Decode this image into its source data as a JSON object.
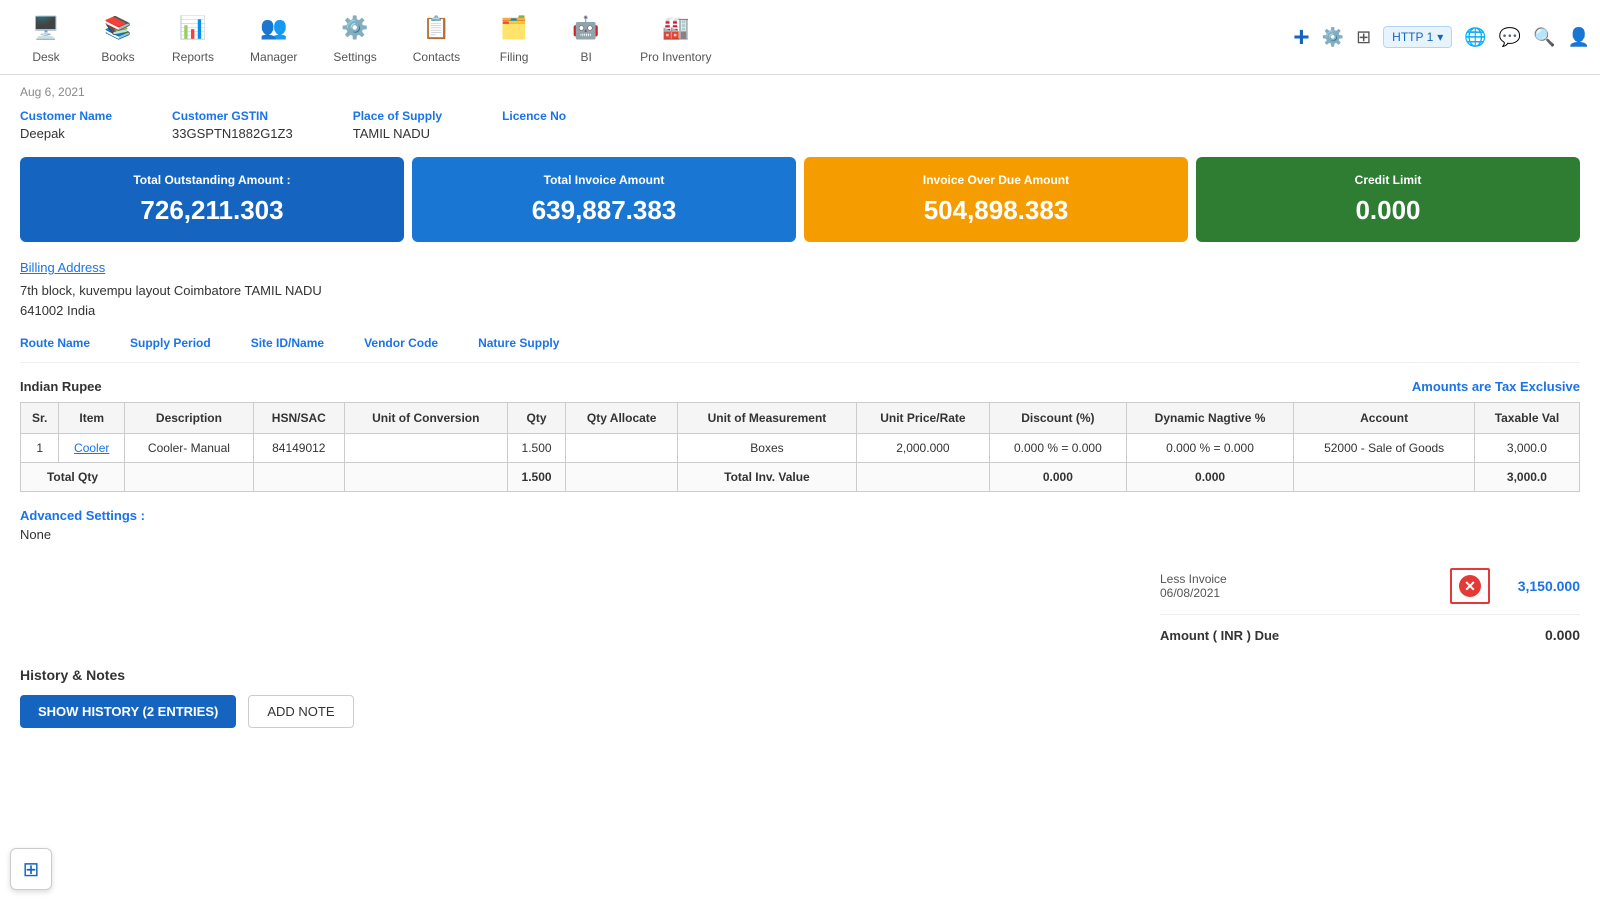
{
  "nav": {
    "items": [
      {
        "id": "desk",
        "label": "Desk",
        "icon": "🖥️"
      },
      {
        "id": "books",
        "label": "Books",
        "icon": "📚"
      },
      {
        "id": "reports",
        "label": "Reports",
        "icon": "📊"
      },
      {
        "id": "manager",
        "label": "Manager",
        "icon": "👥"
      },
      {
        "id": "settings",
        "label": "Settings",
        "icon": "⚙️"
      },
      {
        "id": "contacts",
        "label": "Contacts",
        "icon": "📋"
      },
      {
        "id": "filing",
        "label": "Filing",
        "icon": "🗂️"
      },
      {
        "id": "bi",
        "label": "BI",
        "icon": "🤖"
      },
      {
        "id": "pro_inventory",
        "label": "Pro Inventory",
        "icon": "🏭"
      }
    ],
    "right": {
      "plus": "+",
      "gear": "⚙️",
      "grid": "⊞",
      "http": "HTTP 1",
      "globe": "🌐",
      "chat": "💬",
      "search": "🔍",
      "user": "👤"
    }
  },
  "page": {
    "date": "Aug 6, 2021",
    "customer": {
      "name_label": "Customer Name",
      "name_value": "Deepak",
      "gstin_label": "Customer GSTIN",
      "gstin_value": "33GSPTN1882G1Z3",
      "supply_label": "Place of Supply",
      "supply_value": "TAMIL NADU",
      "licence_label": "Licence No",
      "licence_value": ""
    },
    "summary_cards": [
      {
        "label": "Total Outstanding Amount :",
        "value": "726,211.303",
        "color_class": "card-blue1"
      },
      {
        "label": "Total Invoice Amount",
        "value": "639,887.383",
        "color_class": "card-blue2"
      },
      {
        "label": "Invoice Over Due Amount",
        "value": "504,898.383",
        "color_class": "card-amber"
      },
      {
        "label": "Credit Limit",
        "value": "0.000",
        "color_class": "card-green"
      }
    ],
    "billing": {
      "link_label": "Billing Address",
      "address_line1": "7th block, kuvempu layout Coimbatore TAMIL NADU",
      "address_line2": "641002 India"
    },
    "supply_row": {
      "route_name": "Route Name",
      "supply_period": "Supply Period",
      "site_id": "Site ID/Name",
      "vendor_code": "Vendor Code",
      "nature_supply": "Nature Supply"
    },
    "currency": "Indian Rupee",
    "tax_note": "Amounts are Tax Exclusive",
    "table": {
      "headers": [
        "Sr.",
        "Item",
        "Description",
        "HSN/SAC",
        "Unit of Conversion",
        "Qty",
        "Qty Allocate",
        "Unit of Measurement",
        "Unit Price/Rate",
        "Discount (%)",
        "Dynamic Nagtive %",
        "Account",
        "Taxable Val"
      ],
      "rows": [
        {
          "sr": "1",
          "item": "Cooler",
          "description": "Cooler- Manual",
          "hsn": "84149012",
          "uoc": "",
          "qty": "1.500",
          "qty_allocate": "",
          "uom": "Boxes",
          "unit_price": "2,000.000",
          "discount": "0.000 % = 0.000",
          "dynamic": "0.000 % = 0.000",
          "account": "52000 - Sale of Goods",
          "taxable_val": "3,000.0"
        }
      ],
      "total_row": {
        "label": "Total Qty",
        "qty": "1.500",
        "total_inv_label": "Total Inv. Value",
        "discount_total": "0.000",
        "dynamic_total": "0.000",
        "taxable_total": "3,000.0"
      }
    },
    "advanced_settings": {
      "label": "Advanced Settings :",
      "value": "None"
    },
    "less_invoice": {
      "label": "Less Invoice",
      "date": "06/08/2021",
      "amount": "3,150.000"
    },
    "amount_due": {
      "label": "Amount ( INR ) Due",
      "value": "0.000"
    },
    "history": {
      "title": "History & Notes",
      "show_history_btn": "SHOW HISTORY (2 ENTRIES)",
      "add_note_btn": "ADD NOTE"
    }
  }
}
